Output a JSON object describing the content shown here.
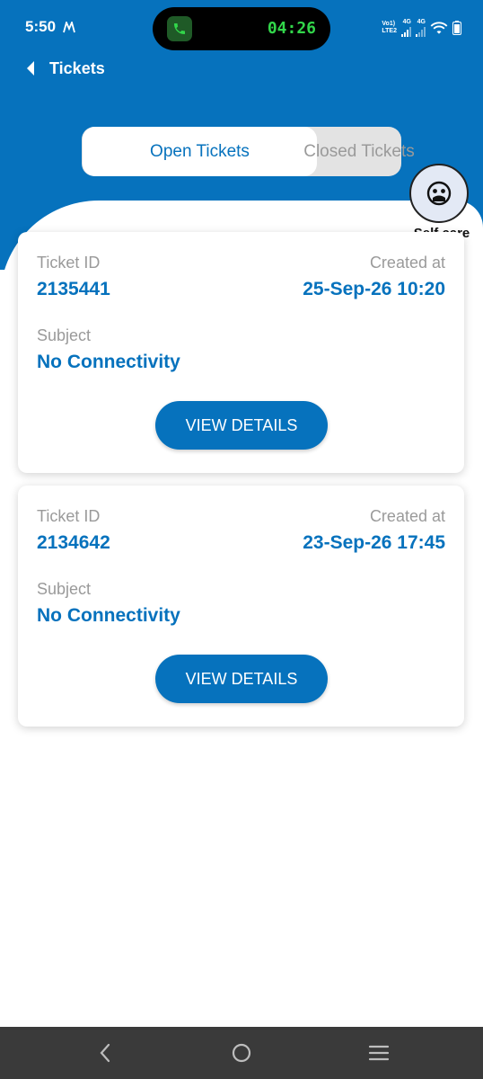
{
  "status_bar": {
    "time": "5:50",
    "call_timer": "04:26",
    "sim1_label_top": "Vo1)",
    "sim1_label_bottom": "LTE2",
    "sim1_net": "4G",
    "sim2_net": "4G",
    "icons": [
      "phone-icon",
      "wifi-icon",
      "battery-icon"
    ]
  },
  "header": {
    "title": "Tickets"
  },
  "tabs": [
    {
      "label": "Open Tickets",
      "active": true
    },
    {
      "label": "Closed Tickets",
      "active": false
    }
  ],
  "self_care": {
    "label": "Self care"
  },
  "tickets": [
    {
      "id_label": "Ticket ID",
      "id": "2135441",
      "created_label": "Created at",
      "created": "25-Sep-26 10:20",
      "subject_label": "Subject",
      "subject": "No Connectivity",
      "button": "VIEW DETAILS"
    },
    {
      "id_label": "Ticket ID",
      "id": "2134642",
      "created_label": "Created at",
      "created": "23-Sep-26 17:45",
      "subject_label": "Subject",
      "subject": "No Connectivity",
      "button": "VIEW DETAILS"
    }
  ],
  "colors": {
    "brand_blue": "#0672bd",
    "inactive_tab_text": "#9a9a9a",
    "nav_bar": "#3a3a3a"
  }
}
